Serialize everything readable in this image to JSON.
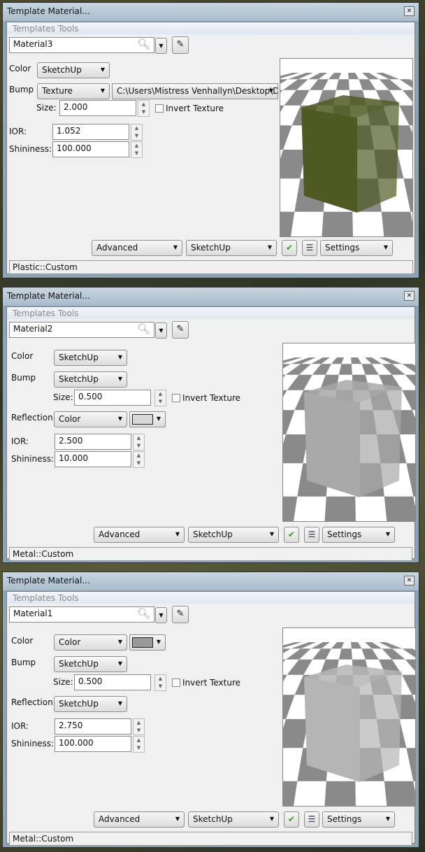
{
  "windows": [
    {
      "title": "Template Material...",
      "menu": [
        "Templates",
        "Tools"
      ],
      "material_name": "Material3",
      "rows": [
        {
          "label": "Color",
          "select": "SketchUp"
        },
        {
          "label": "Bump",
          "select": "Texture",
          "path": "C:\\Users\\Mistress Venhallyn\\Desktop\\De"
        }
      ],
      "size_label": "Size:",
      "size": "2.000",
      "invert_label": "Invert Texture",
      "ior_label": "IOR:",
      "ior": "1.052",
      "shininess_label": "Shininess:",
      "shininess": "100.000",
      "bottom": {
        "advanced": "Advanced",
        "renderer": "SketchUp",
        "settings": "Settings"
      },
      "status": "Plastic::Custom",
      "cube_color": "#4f5a22"
    },
    {
      "title": "Template Material...",
      "menu": [
        "Templates",
        "Tools"
      ],
      "material_name": "Material2",
      "rows": [
        {
          "label": "Color",
          "select": "SketchUp"
        },
        {
          "label": "Bump",
          "select": "SketchUp"
        },
        {
          "label": "Reflection",
          "select": "Color",
          "swatch": "#d8d8d8"
        }
      ],
      "size_label": "Size:",
      "size": "0.500",
      "invert_label": "Invert Texture",
      "ior_label": "IOR:",
      "ior": "2.500",
      "shininess_label": "Shininess:",
      "shininess": "10.000",
      "bottom": {
        "advanced": "Advanced",
        "renderer": "SketchUp",
        "settings": "Settings"
      },
      "status": "Metal::Custom",
      "cube_color": "#a8a8a8"
    },
    {
      "title": "Template Material...",
      "menu": [
        "Templates",
        "Tools"
      ],
      "material_name": "Material1",
      "rows": [
        {
          "label": "Color",
          "select": "Color",
          "swatch": "#999999"
        },
        {
          "label": "Bump",
          "select": "SketchUp"
        },
        {
          "label": "Reflection",
          "select": "SketchUp"
        }
      ],
      "size_label": "Size:",
      "size": "0.500",
      "invert_label": "Invert Texture",
      "ior_label": "IOR:",
      "ior": "2.750",
      "shininess_label": "Shininess:",
      "shininess": "100.000",
      "bottom": {
        "advanced": "Advanced",
        "renderer": "SketchUp",
        "settings": "Settings"
      },
      "status": "Metal::Custom",
      "cube_color": "#b5b5b5"
    }
  ]
}
